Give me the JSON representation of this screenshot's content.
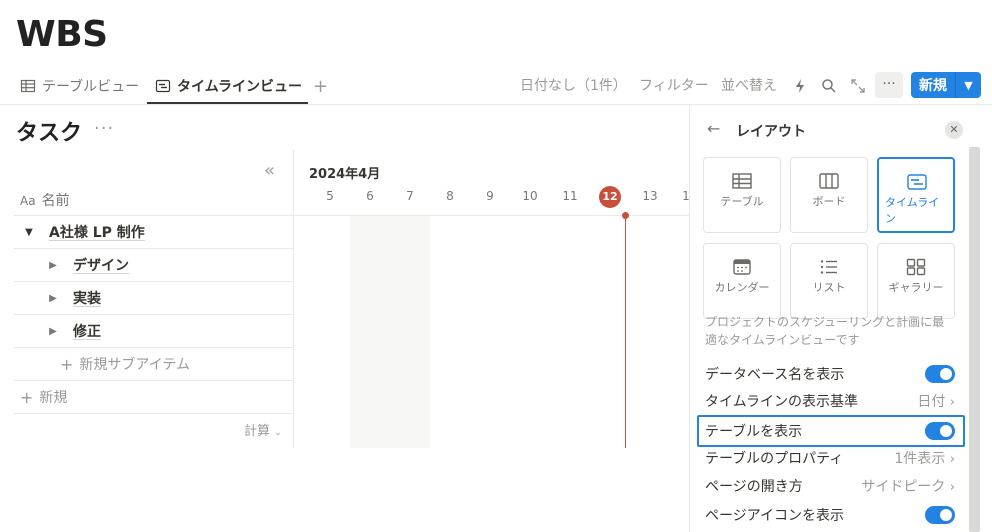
{
  "page": {
    "title": "WBS"
  },
  "tabs": [
    {
      "label": "テーブルビュー",
      "icon": "table-icon"
    },
    {
      "label": "タイムラインビュー",
      "icon": "timeline-icon",
      "active": true
    }
  ],
  "toolbar": {
    "date_filter": "日付なし（1件）",
    "filter": "フィルター",
    "sort": "並べ替え",
    "more": "···",
    "new_label": "新規"
  },
  "database": {
    "title": "タスク",
    "more": "···"
  },
  "table": {
    "column_header": "名前",
    "column_icon": "Aa",
    "rows": [
      {
        "label": "A社様 LP 制作",
        "level": 0,
        "expanded": true
      },
      {
        "label": "デザイン",
        "level": 1
      },
      {
        "label": "実装",
        "level": 1
      },
      {
        "label": "修正",
        "level": 1
      }
    ],
    "new_sub_item": "新規サブアイテム",
    "new_item": "新規",
    "calculate": "計算"
  },
  "timeline": {
    "month": "2024年4月",
    "days": [
      "5",
      "6",
      "7",
      "8",
      "9",
      "10",
      "11",
      "12",
      "13",
      "1"
    ],
    "today": "12"
  },
  "layout_panel": {
    "title": "レイアウト",
    "options": [
      {
        "label": "テーブル",
        "icon": "table-icon"
      },
      {
        "label": "ボード",
        "icon": "board-icon"
      },
      {
        "label": "タイムライン",
        "icon": "timeline-icon",
        "selected": true
      },
      {
        "label": "カレンダー",
        "icon": "calendar-icon"
      },
      {
        "label": "リスト",
        "icon": "list-icon"
      },
      {
        "label": "ギャラリー",
        "icon": "gallery-icon"
      }
    ],
    "description": "プロジェクトのスケジューリングと計画に最適なタイムラインビューです",
    "settings": [
      {
        "label": "データベース名を表示",
        "toggle": true
      },
      {
        "label": "タイムラインの表示基準",
        "value": "日付"
      },
      {
        "label": "テーブルを表示",
        "toggle": true,
        "highlighted": true
      },
      {
        "label": "テーブルのプロパティ",
        "value": "1件表示"
      },
      {
        "label": "ページの開き方",
        "value": "サイドピーク"
      },
      {
        "label": "ページアイコンを表示",
        "toggle": true
      }
    ]
  },
  "colors": {
    "accent": "#2383e2",
    "today": "#c8503b"
  }
}
